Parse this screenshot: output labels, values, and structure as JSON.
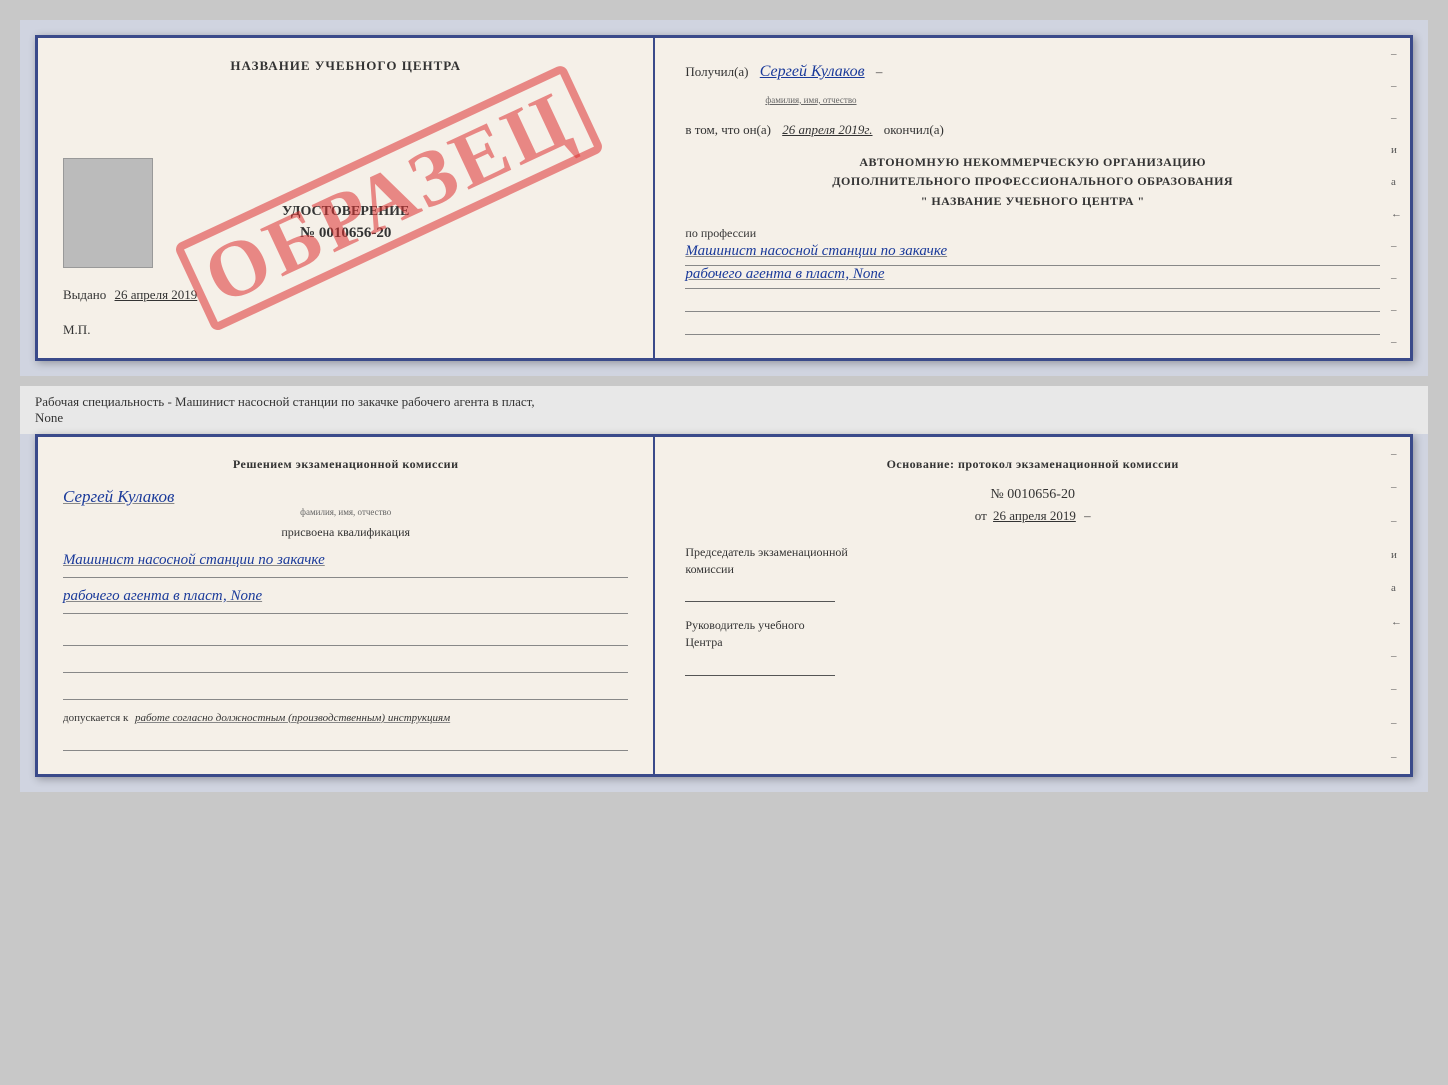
{
  "page": {
    "background_color": "#c8c8c8"
  },
  "top_certificate": {
    "left_panel": {
      "school_name": "НАЗВАНИЕ УЧЕБНОГО ЦЕНТРА",
      "certificate_title": "УДОСТОВЕРЕНИЕ",
      "certificate_number": "№ 0010656-20",
      "issued_label": "Выдано",
      "issued_date": "26 апреля 2019",
      "mp_label": "М.П.",
      "watermark": "ОБРАЗЕЦ"
    },
    "right_panel": {
      "received_prefix": "Получил(а)",
      "received_name": "Сергей Кулаков",
      "name_subtitle": "фамилия, имя, отчество",
      "date_prefix": "в том, что он(а)",
      "date_value": "26 апреля 2019г.",
      "date_suffix": "окончил(а)",
      "org_line1": "АВТОНОМНУЮ НЕКОММЕРЧЕСКУЮ ОРГАНИЗАЦИЮ",
      "org_line2": "ДОПОЛНИТЕЛЬНОГО ПРОФЕССИОНАЛЬНОГО ОБРАЗОВАНИЯ",
      "org_line3": "\"   НАЗВАНИЕ УЧЕБНОГО ЦЕНТРА   \"",
      "profession_label": "по профессии",
      "profession_line1": "Машинист насосной станции по закачке",
      "profession_line2": "рабочего агента в пласт, None"
    }
  },
  "separator": {
    "text": "Рабочая специальность - Машинист насосной станции по закачке рабочего агента в пласт,",
    "text2": "None"
  },
  "bottom_certificate": {
    "left_panel": {
      "commission_title": "Решением экзаменационной комиссии",
      "person_name": "Сергей Кулаков",
      "name_subtitle": "фамилия, имя, отчество",
      "qualification_assigned": "присвоена квалификация",
      "qualification_line1": "Машинист насосной станции по закачке",
      "qualification_line2": "рабочего агента в пласт, None",
      "admitted_prefix": "допускается к",
      "admitted_value": "работе согласно должностным (производственным) инструкциям"
    },
    "right_panel": {
      "basis_title": "Основание: протокол экзаменационной комиссии",
      "protocol_number": "№ 0010656-20",
      "protocol_date_prefix": "от",
      "protocol_date": "26 апреля 2019",
      "chairman_label1": "Председатель экзаменационной",
      "chairman_label2": "комиссии",
      "leader_label1": "Руководитель учебного",
      "leader_label2": "Центра"
    }
  },
  "side_dashes": {
    "items": [
      "-",
      "-",
      "-",
      "и",
      "а",
      "←",
      "-",
      "-",
      "-",
      "-"
    ]
  }
}
